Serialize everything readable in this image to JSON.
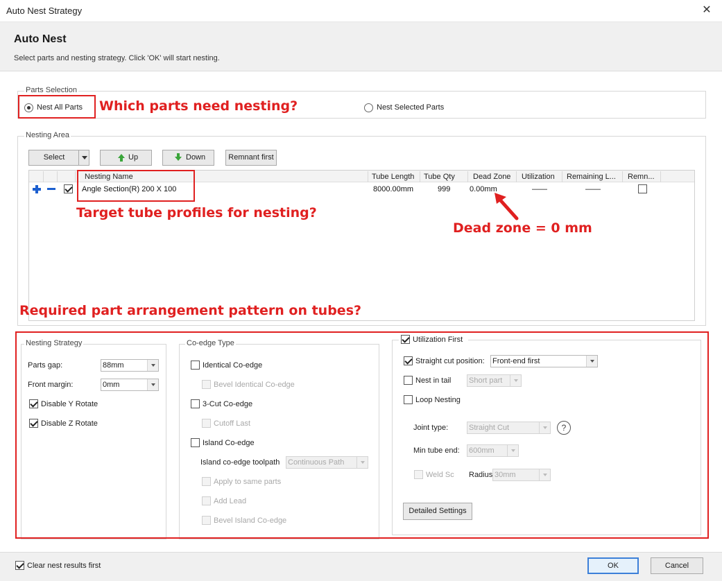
{
  "window": {
    "title": "Auto Nest Strategy",
    "close_glyph": "✕"
  },
  "header": {
    "title": "Auto Nest",
    "subtitle": "Select parts and nesting strategy. Click 'OK' will start nesting."
  },
  "parts_selection": {
    "legend": "Parts Selection",
    "nest_all": {
      "label": "Nest All Parts",
      "checked": true
    },
    "nest_selected": {
      "label": "Nest Selected Parts",
      "checked": false
    }
  },
  "nesting_area": {
    "legend": "Nesting Area",
    "toolbar": {
      "select": "Select",
      "up": "Up",
      "down": "Down",
      "remnant_first": "Remnant first"
    },
    "columns": [
      "Nesting Name",
      "Tube Length",
      "Tube Qty",
      "Dead Zone",
      "Utilization",
      "Remaining L...",
      "Remn..."
    ],
    "rows": [
      {
        "checked": true,
        "name": "Angle Section(R) 200 X 100",
        "tube_length": "8000.00mm",
        "tube_qty": "999",
        "dead_zone": "0.00mm",
        "utilization": "——",
        "remaining": "——",
        "remnant": false
      }
    ]
  },
  "nesting_strategy": {
    "legend": "Nesting Strategy",
    "parts_gap_label": "Parts gap:",
    "parts_gap_value": "88mm",
    "front_margin_label": "Front margin:",
    "front_margin_value": "0mm",
    "disable_y": {
      "label": "Disable Y Rotate",
      "checked": true
    },
    "disable_z": {
      "label": "Disable Z Rotate",
      "checked": true
    }
  },
  "coedge": {
    "legend": "Co-edge Type",
    "identical": "Identical Co-edge",
    "bevel_identical": "Bevel Identical Co-edge",
    "three_cut": "3-Cut Co-edge",
    "cutoff_last": "Cutoff Last",
    "island": "Island Co-edge",
    "island_toolpath_label": "Island co-edge toolpath",
    "island_toolpath_value": "Continuous Path",
    "apply_same": "Apply to same parts",
    "add_lead": "Add Lead",
    "bevel_island": "Bevel Island Co-edge"
  },
  "utilization": {
    "legend": "Utilization First",
    "legend_checked": true,
    "straight_cut": {
      "label": "Straight cut position:",
      "checked": true,
      "value": "Front-end first"
    },
    "nest_in_tail": {
      "label": "Nest in tail",
      "checked": false,
      "value": "Short part"
    },
    "loop_nesting": {
      "label": "Loop Nesting",
      "checked": false
    },
    "joint_type_label": "Joint type:",
    "joint_type_value": "Straight Cut",
    "min_tube_end_label": "Min tube end:",
    "min_tube_end_value": "600mm",
    "weld_label": "Weld Sc",
    "radius_label": "Radius:",
    "radius_value": "30mm",
    "help_glyph": "?",
    "detailed_settings": "Detailed Settings"
  },
  "footer": {
    "clear_nest": {
      "label": "Clear nest results first",
      "checked": true
    },
    "ok": "OK",
    "cancel": "Cancel"
  },
  "annotations": {
    "which_parts": "Which parts need nesting?",
    "target_profiles": "Target tube profiles for nesting?",
    "dead_zone": "Dead zone = 0 mm",
    "arrangement": "Required part arrangement pattern on tubes?"
  },
  "colors": {
    "annotation_red": "#e02020",
    "accent_blue": "#1e6fd9",
    "add_icon": "#1c5fcf",
    "up_arrow": "#3aa53a",
    "down_arrow": "#3aa53a"
  }
}
